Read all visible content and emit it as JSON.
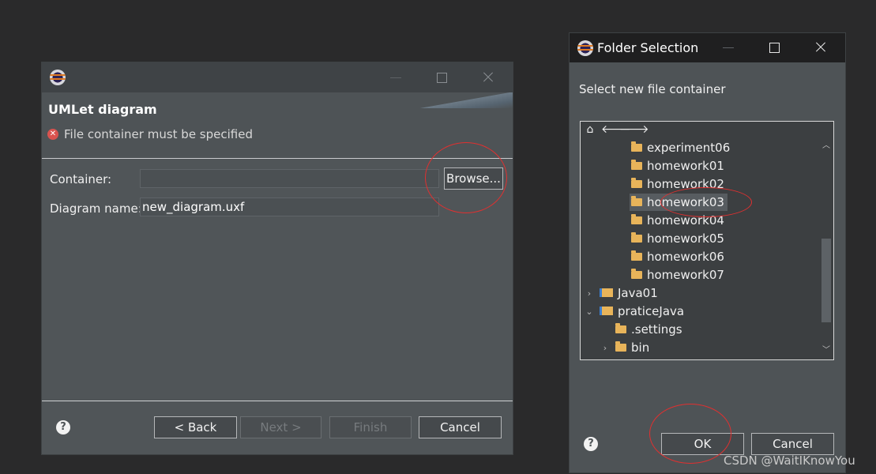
{
  "wizard": {
    "title": "UMLet diagram",
    "error_message": "File container must be specified",
    "container_label": "Container:",
    "container_value": "",
    "browse_label": "Browse...",
    "diagram_name_label": "Diagram name:",
    "diagram_name_value": "new_diagram.uxf",
    "buttons": {
      "back": "< Back",
      "next": "Next >",
      "finish": "Finish",
      "cancel": "Cancel"
    },
    "help": "?"
  },
  "folder_dialog": {
    "title": "Folder Selection",
    "prompt": "Select new file container",
    "tree": [
      {
        "label": "experiment06",
        "kind": "folder"
      },
      {
        "label": "homework01",
        "kind": "folder"
      },
      {
        "label": "homework02",
        "kind": "folder"
      },
      {
        "label": "homework03",
        "kind": "folder",
        "selected": true
      },
      {
        "label": "homework04",
        "kind": "folder"
      },
      {
        "label": "homework05",
        "kind": "folder"
      },
      {
        "label": "homework06",
        "kind": "folder"
      },
      {
        "label": "homework07",
        "kind": "folder"
      },
      {
        "label": "Java01",
        "kind": "project",
        "expanded": false
      },
      {
        "label": "praticeJava",
        "kind": "project",
        "expanded": true
      },
      {
        "label": ".settings",
        "kind": "folder"
      },
      {
        "label": "bin",
        "kind": "folder",
        "expanded": false
      }
    ],
    "buttons": {
      "ok": "OK",
      "cancel": "Cancel"
    },
    "help": "?"
  },
  "watermark": "CSDN @WaitIKnowYou",
  "colors": {
    "annotation": "#e03030",
    "folder": "#e8b45a",
    "error": "#d9534f"
  }
}
